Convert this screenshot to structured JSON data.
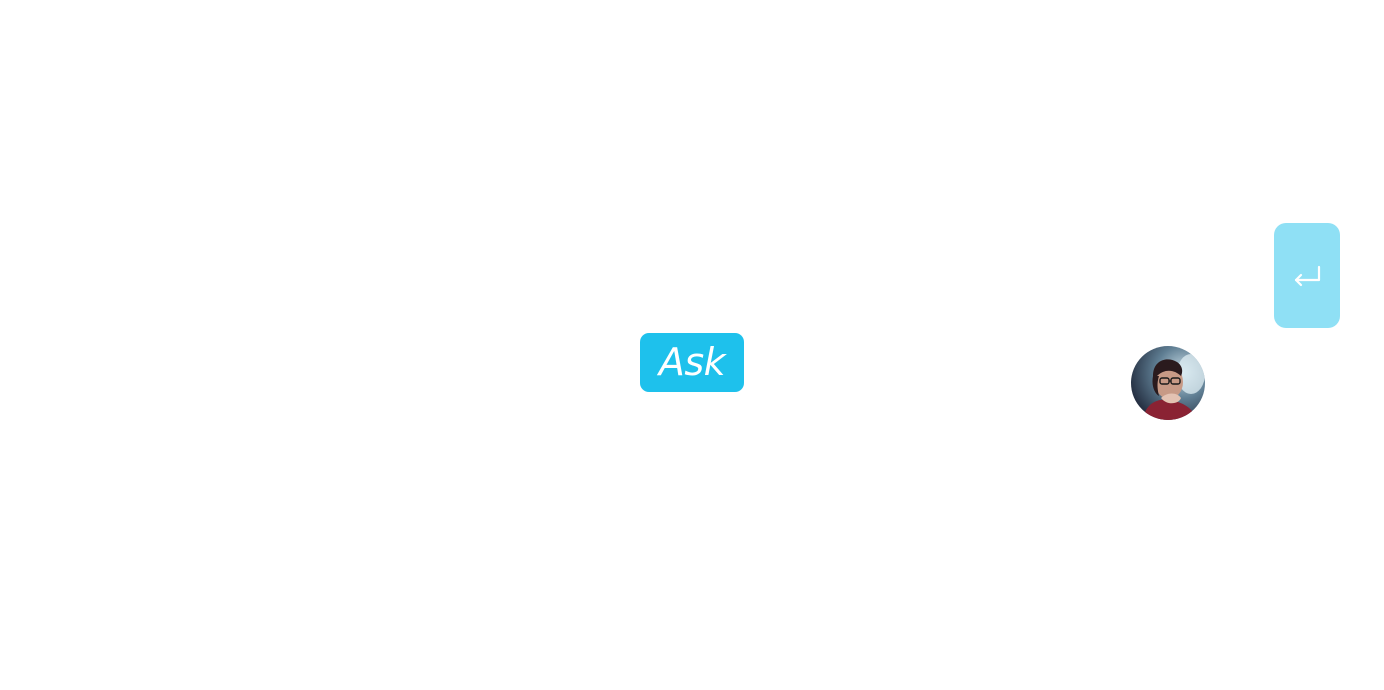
{
  "ask_button": {
    "label": "Ask"
  },
  "avatar": {
    "alt": "user avatar"
  },
  "enter_button": {
    "icon": "enter-return-icon"
  },
  "colors": {
    "background": "#ffffff",
    "accent": "#1ec1ec",
    "enter_button": "#8fe0f5"
  }
}
